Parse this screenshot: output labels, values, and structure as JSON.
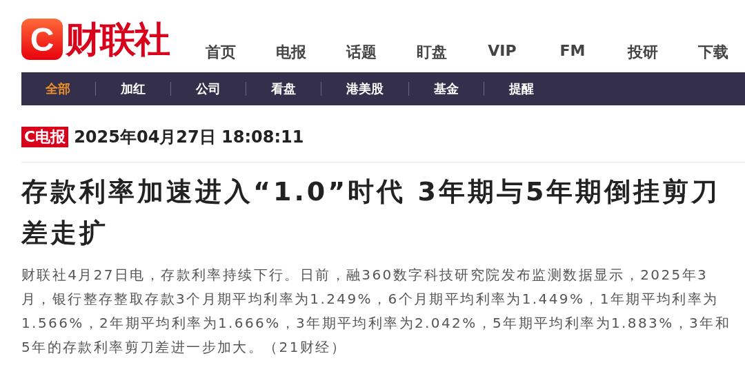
{
  "logo": {
    "mark": "C",
    "name": "财联社"
  },
  "main_nav": [
    {
      "label": "首页"
    },
    {
      "label": "电报"
    },
    {
      "label": "话题"
    },
    {
      "label": "盯盘"
    },
    {
      "label": "VIP"
    },
    {
      "label": "FM"
    },
    {
      "label": "投研"
    },
    {
      "label": "下载"
    }
  ],
  "category_tabs": [
    {
      "label": "全部",
      "selected": true
    },
    {
      "label": "加红",
      "selected": false
    },
    {
      "label": "公司",
      "selected": false
    },
    {
      "label": "看盘",
      "selected": false
    },
    {
      "label": "港美股",
      "selected": false
    },
    {
      "label": "基金",
      "selected": false
    },
    {
      "label": "提醒",
      "selected": false
    }
  ],
  "article": {
    "badge": "C电报",
    "timestamp": "2025年04月27日 18:08:11",
    "headline": "存款利率加速进入“1.0”时代 3年期与5年期倒挂剪刀差走扩",
    "body": "财联社4月27日电，存款利率持续下行。日前，融360数字科技研究院发布监测数据显示，2025年3月，银行整存整取存款3个月期平均利率为1.249%，6个月期平均利率为1.449%，1年期平均利率为1.566%，2年期平均利率为1.666%，3年期平均利率为2.042%，5年期平均利率为1.883%，3年和5年的存款利率剪刀差进一步加大。（21财经）"
  }
}
